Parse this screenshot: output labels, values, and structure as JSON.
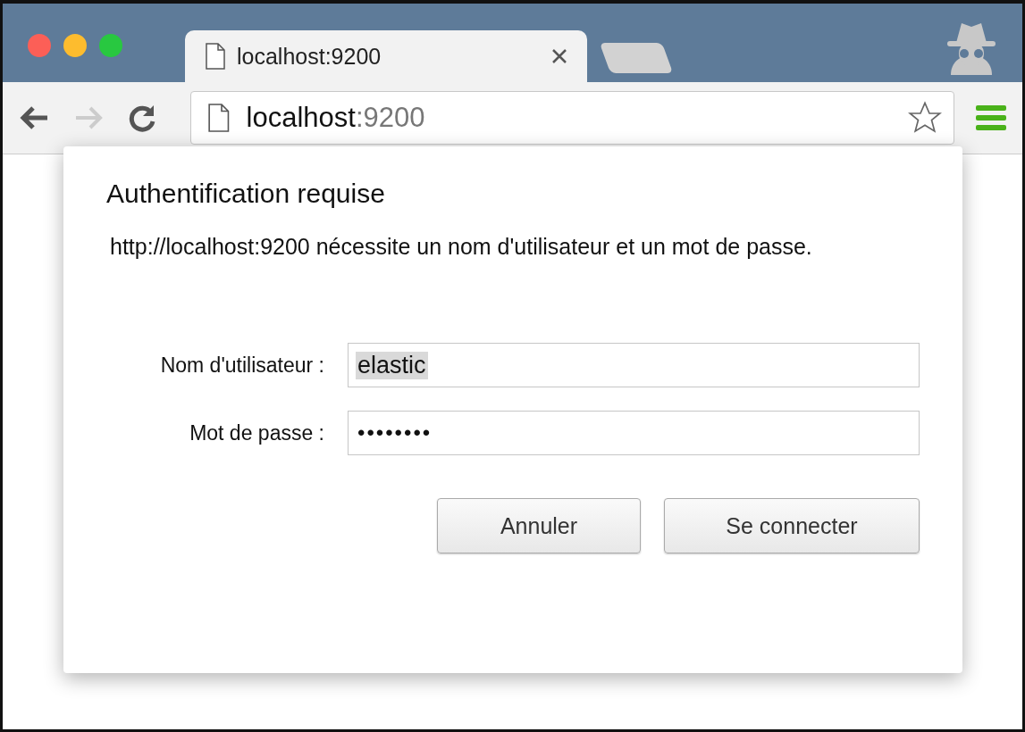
{
  "browser": {
    "tab": {
      "title": "localhost:9200",
      "selected": true
    },
    "address": {
      "host": "localhost",
      "port": ":9200"
    },
    "incognito": true
  },
  "dialog": {
    "title": "Authentification requise",
    "message": "http://localhost:9200 nécessite un nom d'utilisateur et un mot de passe.",
    "fields": [
      {
        "label": "Nom d'utilisateur :",
        "value": "elastic",
        "kind": "text",
        "highlighted": true
      },
      {
        "label": "Mot de passe :",
        "value": "••••••••",
        "kind": "password",
        "highlighted": false
      }
    ],
    "buttons": [
      {
        "label": "Annuler",
        "kind": "cancel"
      },
      {
        "label": "Se connecter",
        "kind": "confirm"
      }
    ]
  }
}
